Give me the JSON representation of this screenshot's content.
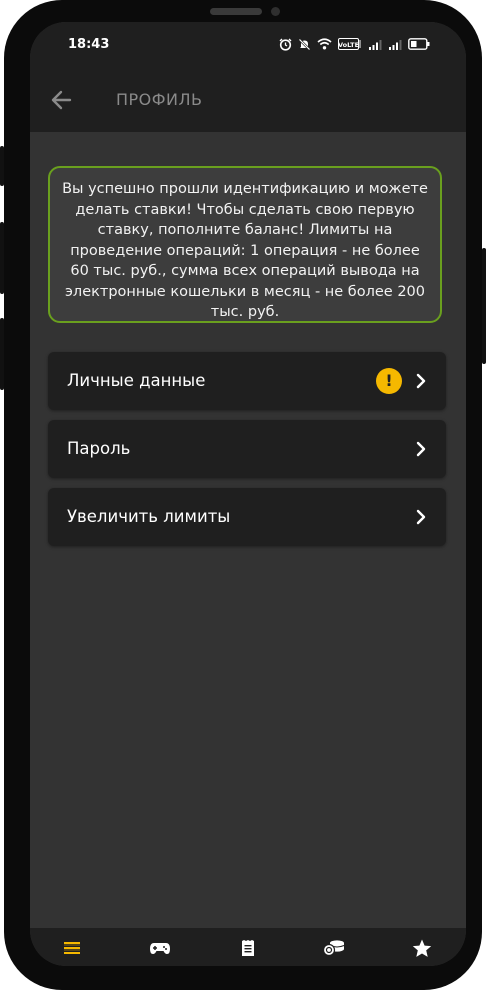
{
  "status_bar": {
    "time": "18:43",
    "icons": [
      "alarm-icon",
      "mute-icon",
      "wifi-icon",
      "volte-icon",
      "signal-icon",
      "signal-icon",
      "battery-icon"
    ],
    "volte_text": "VoLTE"
  },
  "app_bar": {
    "title": "ПРОФИЛЬ",
    "back_icon": "arrow-left-icon"
  },
  "notice": {
    "text": "Вы успешно прошли идентификацию и можете делать ставки! Чтобы сделать свою первую ставку, пополните баланс! Лимиты на проведение операций: 1 операция - не более 60 тыс. руб., сумма всех операций вывода на электронные кошельки в месяц - не более 200 тыс. руб.",
    "border_color": "#6aa01e"
  },
  "menu": {
    "items": [
      {
        "label": "Личные данные",
        "warning": "!"
      },
      {
        "label": "Пароль"
      },
      {
        "label": "Увеличить лимиты"
      }
    ]
  },
  "bottom_nav": {
    "items": [
      {
        "icon": "menu-list-icon",
        "active": true
      },
      {
        "icon": "gamepad-icon",
        "active": false
      },
      {
        "icon": "coupon-icon",
        "active": false
      },
      {
        "icon": "coins-icon",
        "active": false
      },
      {
        "icon": "star-icon",
        "active": false
      }
    ],
    "active_color": "#f5b800"
  },
  "colors": {
    "background": "#333333",
    "surface": "#1f1f1f",
    "accent": "#f5b800",
    "success_border": "#6aa01e"
  }
}
